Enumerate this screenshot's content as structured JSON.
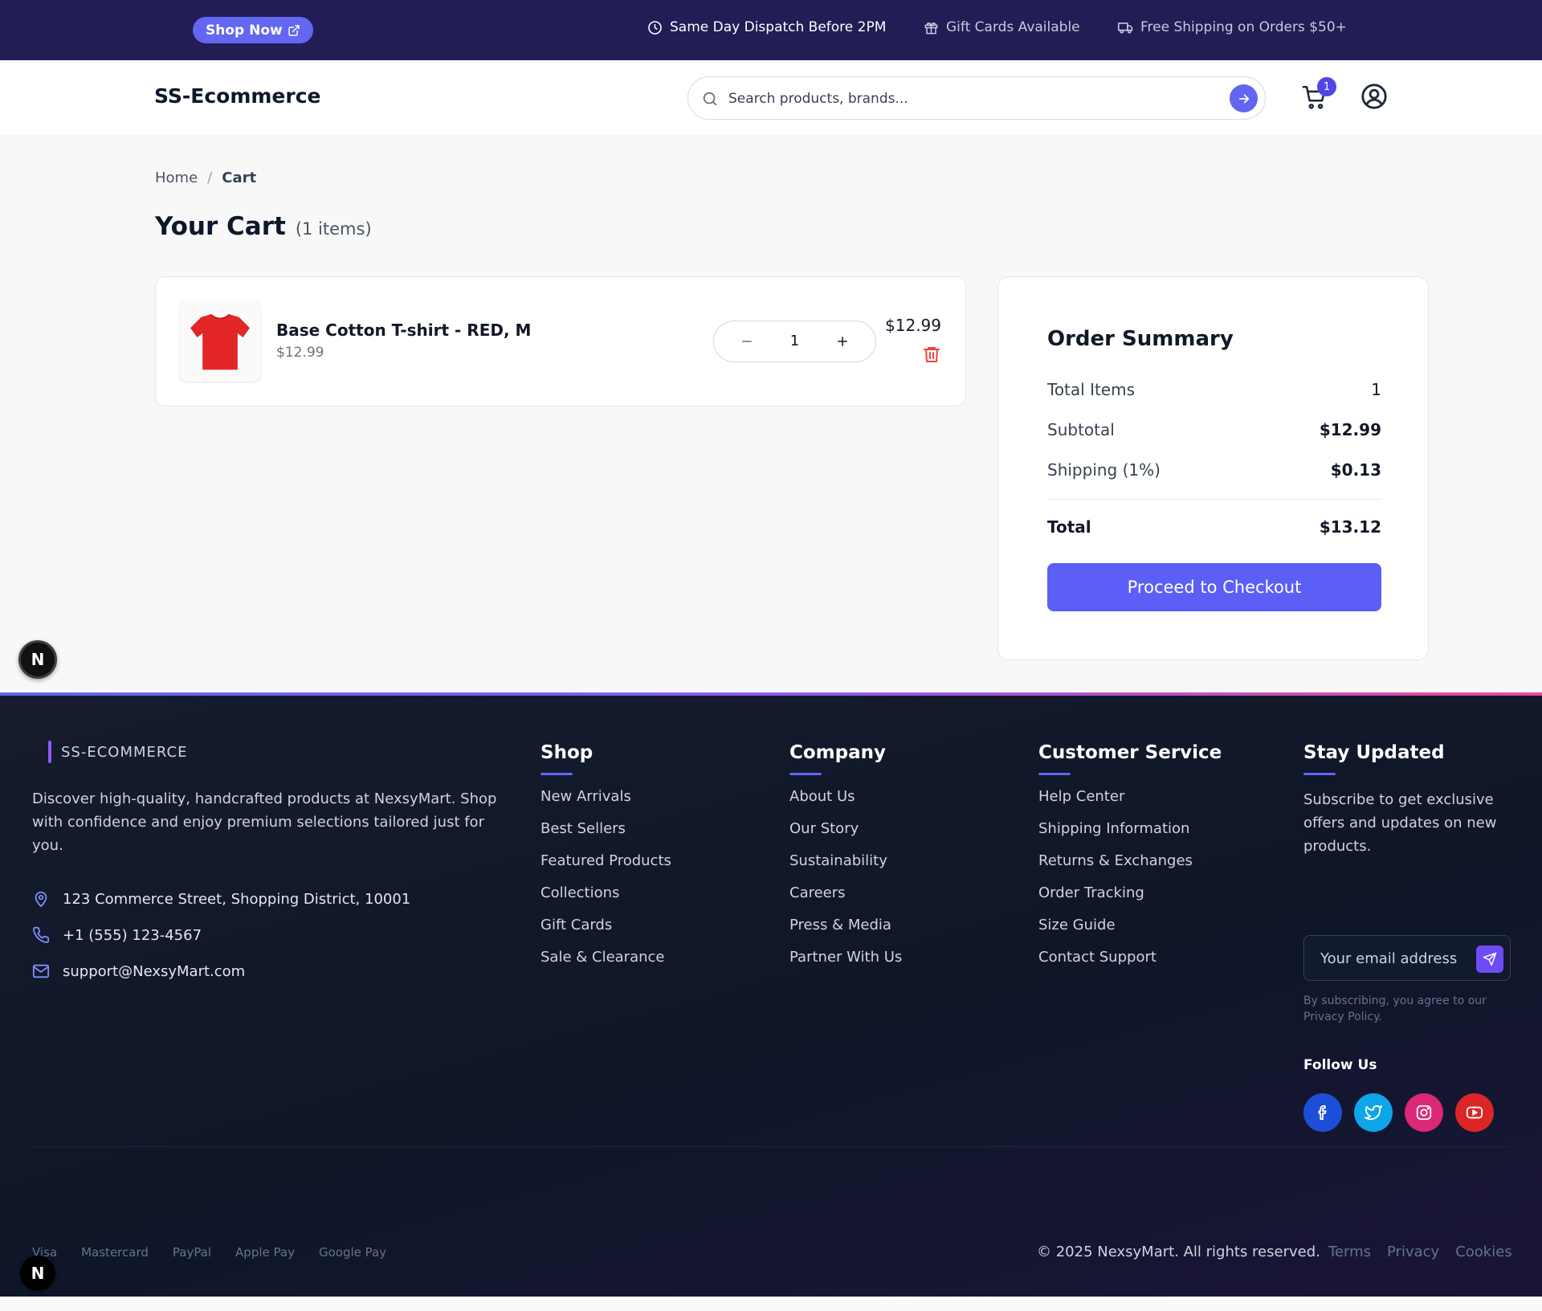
{
  "topbar": {
    "shop_now": "Shop Now",
    "promos": [
      "Same Day Dispatch Before 2PM",
      "Gift Cards Available",
      "Free Shipping on Orders $50+"
    ]
  },
  "header": {
    "logo": "SS-Ecommerce",
    "search_placeholder": "Search products, brands...",
    "cart_count": "1"
  },
  "breadcrumb": {
    "home": "Home",
    "separator": "/",
    "current": "Cart"
  },
  "cart": {
    "title": "Your Cart",
    "count_text": "(1 items)",
    "items": [
      {
        "name": "Base Cotton T-shirt - RED, M",
        "unit_price": "$12.99",
        "quantity": "1",
        "line_total": "$12.99",
        "image_icon": "tshirt-icon",
        "image_color": "#e32626"
      }
    ]
  },
  "summary": {
    "title": "Order Summary",
    "rows": [
      {
        "label": "Total Items",
        "value": "1"
      },
      {
        "label": "Subtotal",
        "value": "$12.99"
      },
      {
        "label": "Shipping (1%)",
        "value": "$0.13"
      }
    ],
    "total_label": "Total",
    "total_value": "$13.12",
    "checkout_label": "Proceed to Checkout"
  },
  "badge": {
    "letter": "N"
  },
  "footer": {
    "brand": "SS-ECOMMERCE",
    "description": "Discover high-quality, handcrafted products at NexsyMart. Shop with confidence and enjoy premium selections tailored just for you.",
    "contact": {
      "address": "123 Commerce Street, Shopping District, 10001",
      "phone": "+1 (555) 123-4567",
      "email": "support@NexsyMart.com"
    },
    "columns": [
      {
        "title": "Shop",
        "links": [
          "New Arrivals",
          "Best Sellers",
          "Featured Products",
          "Collections",
          "Gift Cards",
          "Sale & Clearance"
        ]
      },
      {
        "title": "Company",
        "links": [
          "About Us",
          "Our Story",
          "Sustainability",
          "Careers",
          "Press & Media",
          "Partner With Us"
        ]
      },
      {
        "title": "Customer Service",
        "links": [
          "Help Center",
          "Shipping Information",
          "Returns & Exchanges",
          "Order Tracking",
          "Size Guide",
          "Contact Support"
        ]
      }
    ],
    "newsletter": {
      "title": "Stay Updated",
      "text": "Subscribe to get exclusive offers and updates on new products.",
      "placeholder": "Your email address",
      "disclaimer": "By subscribing, you agree to our Privacy Policy.",
      "follow": "Follow Us"
    },
    "payments": [
      "Visa",
      "Mastercard",
      "PayPal",
      "Apple Pay",
      "Google Pay"
    ],
    "copyright": "© 2025 NexsyMart. All rights reserved.",
    "legal": [
      "Terms",
      "Privacy",
      "Cookies"
    ]
  },
  "colors": {
    "accent": "#6366f1",
    "topbar": "#221d54",
    "footer": "#0e1628",
    "delete": "#ef4444"
  }
}
